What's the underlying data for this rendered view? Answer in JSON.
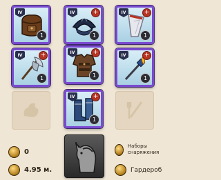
{
  "slots": {
    "bag": {
      "tier": "IV",
      "quantity": "1"
    },
    "head": {
      "tier": "IV",
      "quantity": "1",
      "enchant": "+"
    },
    "cape": {
      "tier": "IV",
      "quantity": "1",
      "enchant": "+"
    },
    "weapon": {
      "tier": "IV",
      "quantity": "1",
      "enchant": "+"
    },
    "armor": {
      "tier": "IV",
      "quantity": "1",
      "enchant": "+"
    },
    "offhand": {
      "tier": "IV",
      "quantity": "1",
      "enchant": "+"
    },
    "boots": {
      "tier": "IV",
      "quantity": "1",
      "enchant": "+"
    }
  },
  "stats": {
    "silver_value": "0",
    "item_power": "4.95 м."
  },
  "actions": {
    "equipment_sets": "Наборы снаряжения",
    "wardrobe": "Гардероб"
  },
  "colors": {
    "rarity_border": "#7a4ad0",
    "background": "#efe6d6",
    "enchant_badge": "#b73322"
  }
}
